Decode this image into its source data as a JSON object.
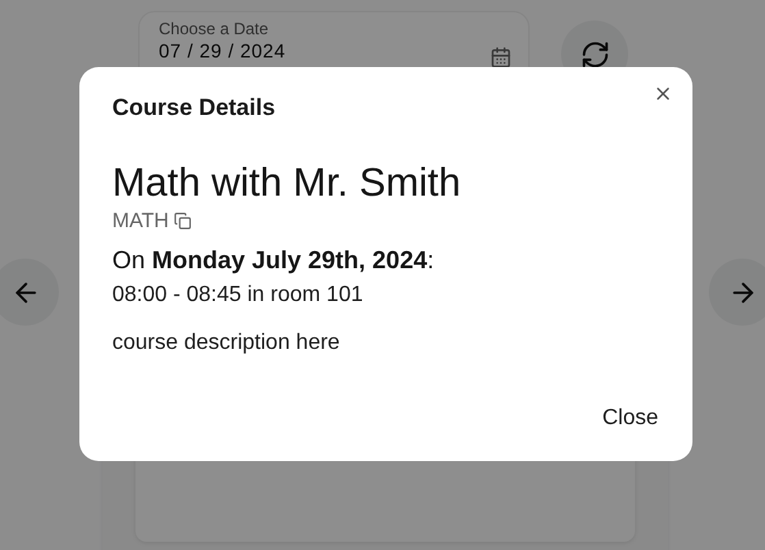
{
  "date_picker": {
    "label": "Choose a Date",
    "value": "07 / 29 / 2024"
  },
  "dialog": {
    "title": "Course Details",
    "course_name": "Math with Mr. Smith",
    "course_code": "MATH",
    "date_line": "On **Monday July 29th, 2024**:",
    "time_room": "08:00 - 08:45 in room 101",
    "description": "course description here",
    "close_button": "Close"
  }
}
